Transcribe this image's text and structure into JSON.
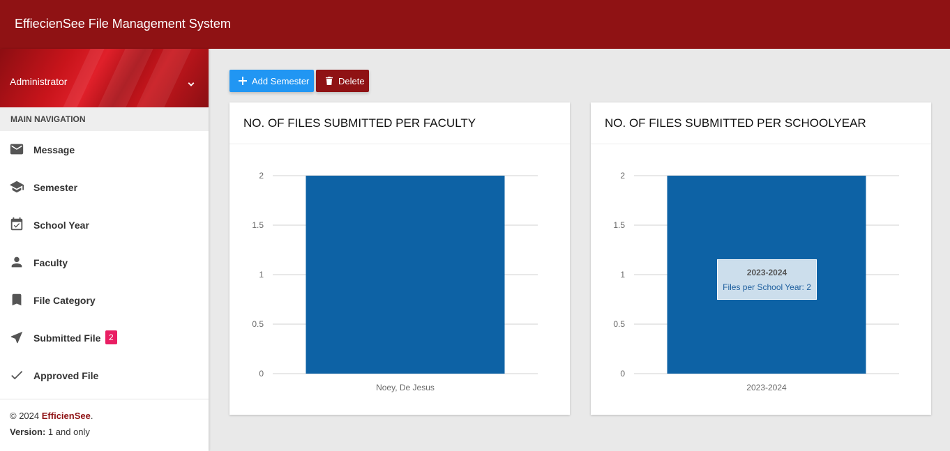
{
  "app": {
    "title": "EffiecienSee File Management System"
  },
  "user": {
    "name": "Administrator"
  },
  "nav": {
    "header": "MAIN NAVIGATION",
    "items": [
      {
        "label": "Message",
        "icon": "mail-icon"
      },
      {
        "label": "Semester",
        "icon": "graduation-cap-icon"
      },
      {
        "label": "School Year",
        "icon": "calendar-check-icon"
      },
      {
        "label": "Faculty",
        "icon": "person-icon"
      },
      {
        "label": "File Category",
        "icon": "bookmark-icon"
      },
      {
        "label": "Submitted File",
        "icon": "send-icon",
        "badge": "2"
      },
      {
        "label": "Approved File",
        "icon": "check-icon"
      }
    ]
  },
  "footer": {
    "copyright": "© 2024",
    "brand": "EfficienSee",
    "dot": ".",
    "version_label": "Version:",
    "version_value": "1 and only"
  },
  "toolbar": {
    "add_label": "Add Semester",
    "delete_label": "Delete"
  },
  "colors": {
    "header": "#8f1214",
    "bar": "#0d62a5",
    "add_button": "#2196f3",
    "badge": "#e91e63"
  },
  "chart_data": [
    {
      "type": "bar",
      "title": "NO. OF FILES SUBMITTED PER FACULTY",
      "categories": [
        "Noey, De Jesus"
      ],
      "values": [
        2
      ],
      "ylim": [
        0,
        2
      ],
      "yticks": [
        "0",
        "0.5",
        "1",
        "1.5",
        "2"
      ],
      "grid": true
    },
    {
      "type": "bar",
      "title": "NO. OF FILES SUBMITTED PER SCHOOLYEAR",
      "categories": [
        "2023-2024"
      ],
      "values": [
        2
      ],
      "ylim": [
        0,
        2
      ],
      "yticks": [
        "0",
        "0.5",
        "1",
        "1.5",
        "2"
      ],
      "grid": true,
      "tooltip": {
        "title": "2023-2024",
        "text": "Files per School Year: 2"
      }
    }
  ]
}
